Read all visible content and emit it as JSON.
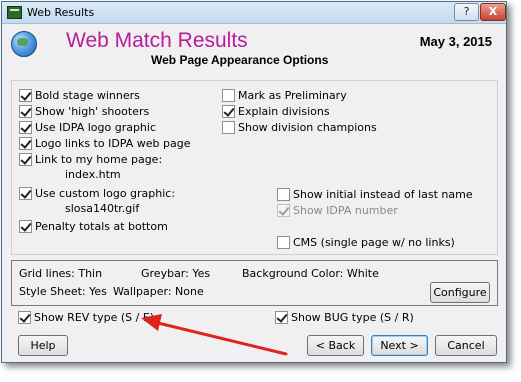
{
  "window": {
    "title": "Web Results",
    "help_button": "?",
    "close_button": "X"
  },
  "header": {
    "app_title": "Web Match Results",
    "date": "May  3, 2015",
    "subtitle": "Web Page Appearance Options"
  },
  "options": {
    "bold_stage_winners": {
      "label": "Bold stage winners",
      "checked": true
    },
    "show_high_shooters": {
      "label": "Show  'high' shooters",
      "checked": true
    },
    "use_idpa_logo": {
      "label": "Use IDPA logo graphic",
      "checked": true
    },
    "logo_links_idpa": {
      "label": "Logo links to IDPA web page",
      "checked": true
    },
    "link_home_page": {
      "label": "Link to my home page:",
      "value": "index.htm",
      "checked": true
    },
    "use_custom_logo": {
      "label": "Use custom logo graphic:",
      "value": "slosa140tr.gif",
      "checked": true
    },
    "penalty_totals": {
      "label": "Penalty totals at bottom",
      "checked": true
    },
    "mark_preliminary": {
      "label": "Mark as Preliminary",
      "checked": false
    },
    "explain_divisions": {
      "label": "Explain divisions",
      "checked": true
    },
    "show_division_champions": {
      "label": "Show division champions",
      "checked": false
    },
    "show_initial": {
      "label": "Show initial instead of last name",
      "checked": false
    },
    "show_idpa_number": {
      "label": "Show IDPA number",
      "checked": true,
      "disabled": true
    },
    "cms": {
      "label": "CMS (single page w/ no links)",
      "checked": false
    }
  },
  "info": {
    "grid_lines": "Grid lines: Thin",
    "greybar": "Greybar: Yes",
    "background_color": "Background Color:  White",
    "style_sheet": "Style Sheet: Yes",
    "wallpaper": "Wallpaper:  None",
    "configure_button": "Configure"
  },
  "bottom_options": {
    "show_rev_type": {
      "label": "Show REV type (S / E)",
      "checked": true
    },
    "show_bug_type": {
      "label": "Show BUG type (S / R)",
      "checked": true
    }
  },
  "buttons": {
    "help": "Help",
    "back": "< Back",
    "next": "Next >",
    "cancel": "Cancel"
  },
  "colors": {
    "title_accent": "#b81d9b",
    "annotation_arrow": "#e0231f"
  }
}
